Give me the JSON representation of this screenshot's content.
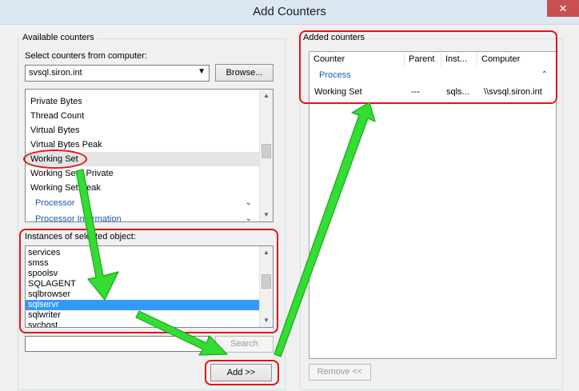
{
  "window": {
    "title": "Add Counters",
    "close_glyph": "✕"
  },
  "available": {
    "group_label": "Available counters",
    "computer_label": "Select counters from computer:",
    "computer_value": "svsql.siron.int",
    "browse_label": "Browse...",
    "counters": [
      "Private Bytes",
      "Thread Count",
      "Virtual Bytes",
      "Virtual Bytes Peak",
      "Working Set",
      "Working Set - Private",
      "Working Set Peak"
    ],
    "categories": [
      {
        "label": "Processor",
        "chevron": "⌄"
      },
      {
        "label": "Processor Information",
        "chevron": "⌄"
      }
    ]
  },
  "instances": {
    "label": "Instances of selected object:",
    "items": [
      "services",
      "smss",
      "spoolsv",
      "SQLAGENT",
      "sqlbrowser",
      "sqlservr",
      "sqlwriter",
      "svchost"
    ],
    "selected": "sqlservr",
    "search_label": "Search"
  },
  "add_label": "Add >>",
  "added": {
    "group_label": "Added counters",
    "columns": [
      "Counter",
      "Parent",
      "Inst...",
      "Computer"
    ],
    "category": "Process",
    "category_chevron": "⌃",
    "rows": [
      {
        "counter": "Working Set",
        "parent": "---",
        "instance": "sqls...",
        "computer": "\\\\svsql.siron.int"
      }
    ],
    "remove_label": "Remove <<"
  },
  "scroll": {
    "up": "▲",
    "down": "▼"
  },
  "accent": {
    "annotation_red": "#e01515",
    "arrow_green": "#33dd33",
    "selection_blue": "#3399ff"
  }
}
